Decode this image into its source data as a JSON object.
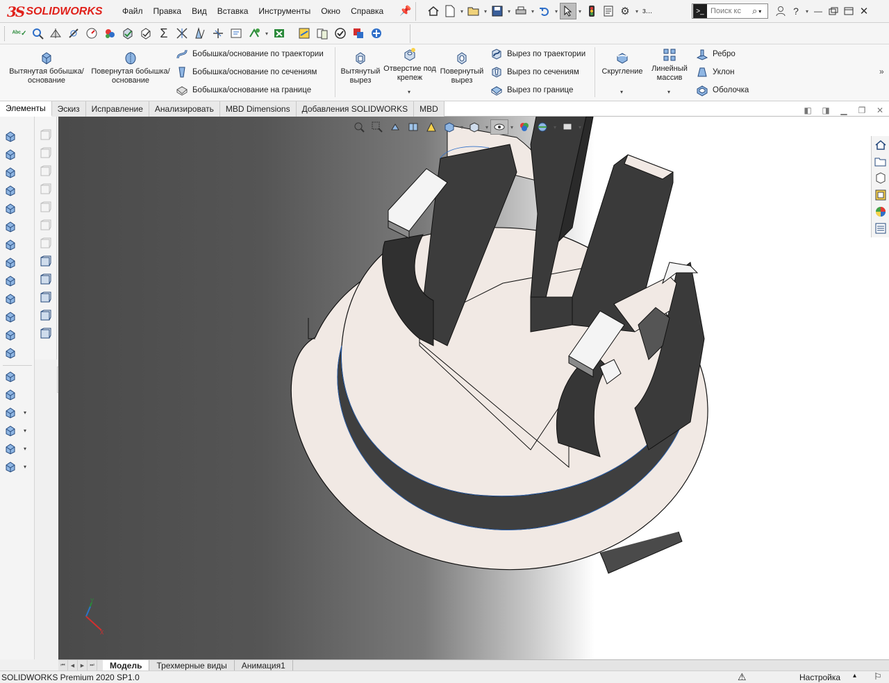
{
  "app": {
    "logo_ds": "3S",
    "logo_name": "SOLIDWORKS"
  },
  "menu": [
    "Файл",
    "Правка",
    "Вид",
    "Вставка",
    "Инструменты",
    "Окно",
    "Справка"
  ],
  "search": {
    "placeholder": "Поиск кс"
  },
  "quick_access_extra": "з...",
  "ribbon": {
    "extruded_boss": "Вытянутая бобышка/основание",
    "revolved_boss": "Повернутая бобышка/основание",
    "swept_boss": "Бобышка/основание по траектории",
    "lofted_boss": "Бобышка/основание по сечениям",
    "boundary_boss": "Бобышка/основание на границе",
    "extruded_cut": "Вытянутый вырез",
    "hole_wizard": "Отверстие под крепеж",
    "revolved_cut": "Повернутый вырез",
    "swept_cut": "Вырез по траектории",
    "lofted_cut": "Вырез по сечениям",
    "boundary_cut": "Вырез по границе",
    "fillet": "Скругление",
    "linear_pattern": "Линейный массив",
    "rib": "Ребро",
    "draft": "Уклон",
    "shell": "Оболочка"
  },
  "tabs": [
    "Элементы",
    "Эскиз",
    "Исправление",
    "Анализировать",
    "MBD Dimensions",
    "Добавления SOLIDWORKS",
    "MBD"
  ],
  "active_tab": "Элементы",
  "bottom_tabs": [
    "Модель",
    "Трехмерные виды",
    "Анимация1"
  ],
  "active_bottom_tab": "Модель",
  "status": {
    "product": "SOLIDWORKS Premium 2020 SP1.0",
    "custom": "Настройка"
  },
  "colors": {
    "accent": "#2f6fc9",
    "brand": "#e0211b",
    "part_face": "#f1e9e4",
    "part_dark": "#3c3c3c"
  },
  "triad_axes": {
    "y": "Y",
    "x": "X"
  }
}
